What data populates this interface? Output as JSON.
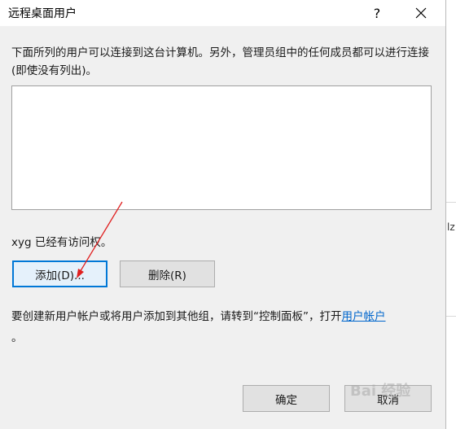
{
  "window": {
    "title": "远程桌面用户",
    "help_label": "?"
  },
  "description": "下面所列的用户可以连接到这台计算机。另外，管理员组中的任何成员都可以进行连接(即使没有列出)。",
  "users": [],
  "access_status": "xyg 已经有访问权。",
  "buttons": {
    "add": "添加(D)...",
    "remove": "删除(R)",
    "ok": "确定",
    "cancel": "取消"
  },
  "info": {
    "text_before_link": "要创建新用户帐户或将用户添加到其他组，请转到“控制面板”，打开",
    "link_text": "用户帐户",
    "text_after_link": "。"
  },
  "background_fragment": "lz",
  "watermark": "Bai 经验",
  "colors": {
    "focus_border": "#0078d7",
    "link": "#0066cc",
    "annotation_arrow": "#e02020"
  }
}
